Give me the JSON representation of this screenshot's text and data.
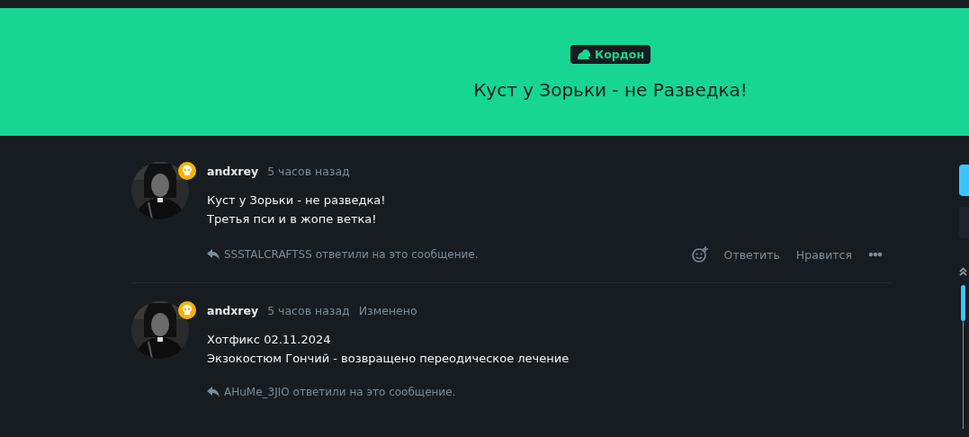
{
  "header": {
    "category": "Кордон",
    "title": "Куст у Зорьки - не Разведка!"
  },
  "posts": [
    {
      "author": "andxrey",
      "time": "5 часов назад",
      "lines": [
        "Куст у Зорьки - не разведка!",
        "Третья пси и в жопе ветка!"
      ],
      "replies": "SSSTALCRAFTSS ответили на это сообщение.",
      "actions": [
        "Ответить",
        "Нравится"
      ]
    },
    {
      "author": "andxrey",
      "time": "5 часов назад",
      "edited": "Изменено",
      "lines": [
        "Хотфикс 02.11.2024",
        "Экзокостюм Гончий - возвращено переодическое лечение"
      ],
      "replies": "AHuMe_3JIO ответили на это сообщение."
    }
  ]
}
